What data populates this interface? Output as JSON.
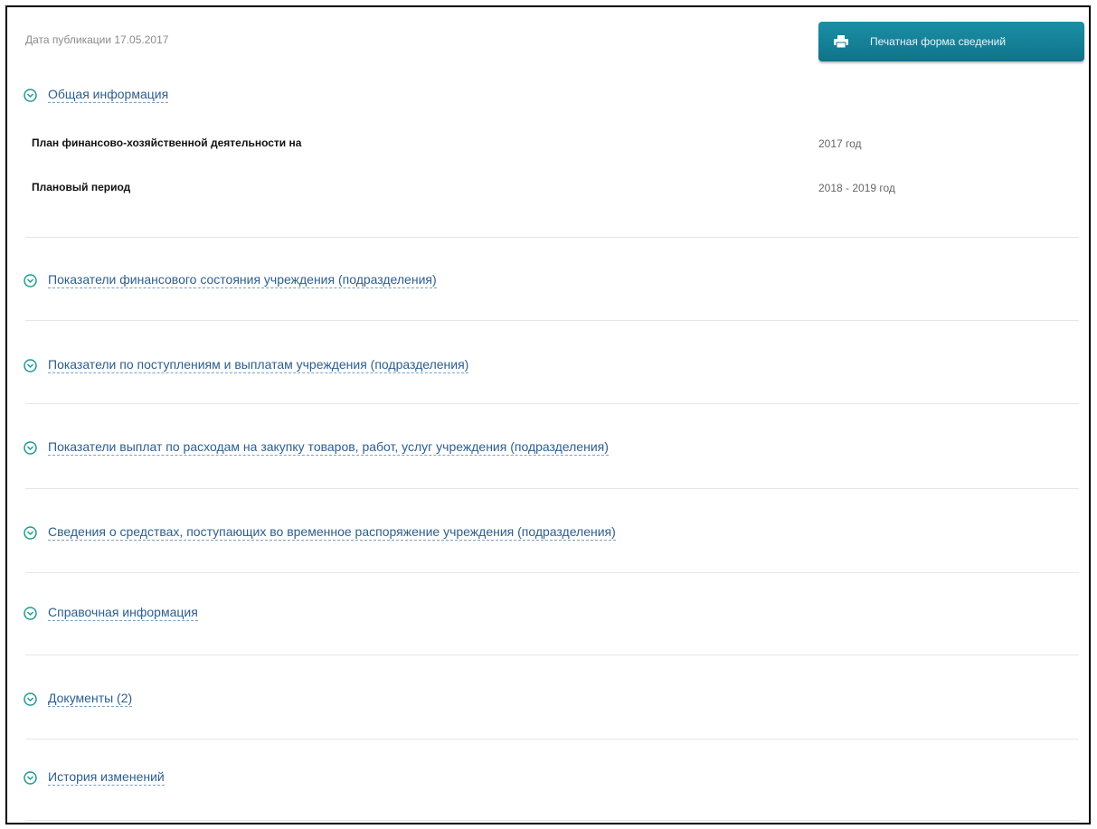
{
  "header": {
    "publication_date": "Дата публикации 17.05.2017",
    "print_button_label": "Печатная форма сведений"
  },
  "general": {
    "title": "Общая информация",
    "rows": [
      {
        "label": "План финансово-хозяйственной деятельности на",
        "value": "2017 год"
      },
      {
        "label": "Плановый период",
        "value": "2018 - 2019 год"
      }
    ]
  },
  "sections": [
    {
      "label": "Показатели финансового состояния учреждения (подразделения)"
    },
    {
      "label": "Показатели по поступлениям и выплатам учреждения (подразделения)"
    },
    {
      "label": "Показатели выплат по расходам на закупку товаров, работ, услуг учреждения (подразделения)"
    },
    {
      "label": "Сведения о средствах, поступающих во временное распоряжение учреждения (подразделения)"
    },
    {
      "label": "Справочная информация"
    },
    {
      "label": "Документы (2)"
    },
    {
      "label": "История изменений"
    }
  ],
  "colors": {
    "link": "#2c5e8f",
    "button": "#1481a0",
    "icon": "#1f9a92"
  },
  "icons": {
    "print": "printer-icon",
    "toggle": "chevron-circle-icon"
  }
}
